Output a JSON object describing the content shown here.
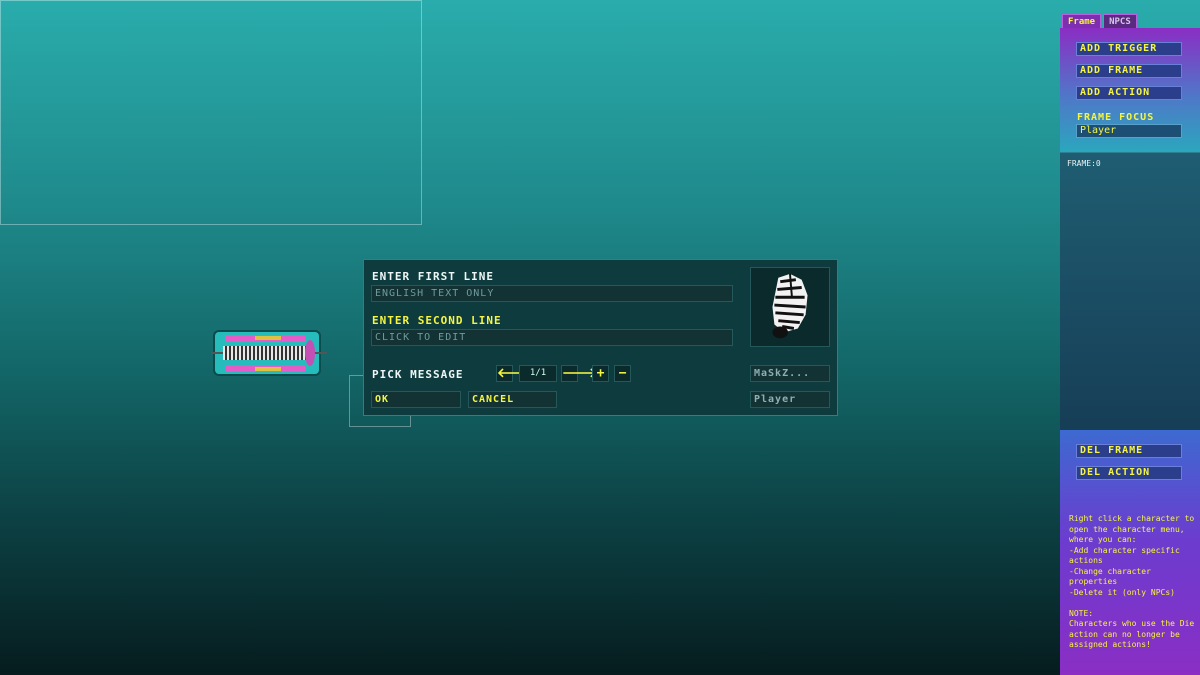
{
  "dialog": {
    "first_line_label": "ENTER FIRST LINE",
    "first_line_placeholder": "ENGLISH TEXT ONLY",
    "second_line_label": "ENTER SECOND LINE",
    "second_line_placeholder": "CLICK TO EDIT",
    "pick_message_label": "PICK MESSAGE",
    "counter": "1/1",
    "add_label": "+",
    "remove_label": "−",
    "prev_label": "🡐",
    "next_label": "🡒",
    "character_name": "MaSkZ...",
    "focus_name": "Player",
    "ok_label": "OK",
    "cancel_label": "CANCEL"
  },
  "panel": {
    "tabs": [
      {
        "label": "Frame",
        "active": true
      },
      {
        "label": "NPCS",
        "active": false
      }
    ],
    "add_trigger": "ADD TRIGGER",
    "add_frame": "ADD FRAME",
    "add_action": "ADD ACTION",
    "frame_focus_label": "FRAME FOCUS",
    "frame_focus_value": "Player",
    "frame_list_item": "FRAME:0",
    "del_frame": "DEL FRAME",
    "del_action": "DEL ACTION",
    "help_text": "Right click a character to open the character menu, where you can:\n-Add character specific  actions\n-Change character  properties\n-Delete it (only NPCs)\n\nNOTE:\nCharacters who use the Die action can no longer be assigned actions!"
  },
  "colors": {
    "accent_yellow": "#f5f542",
    "dialog_bg": "#0e3b3d",
    "panel_purple": "#8a2ec4"
  }
}
